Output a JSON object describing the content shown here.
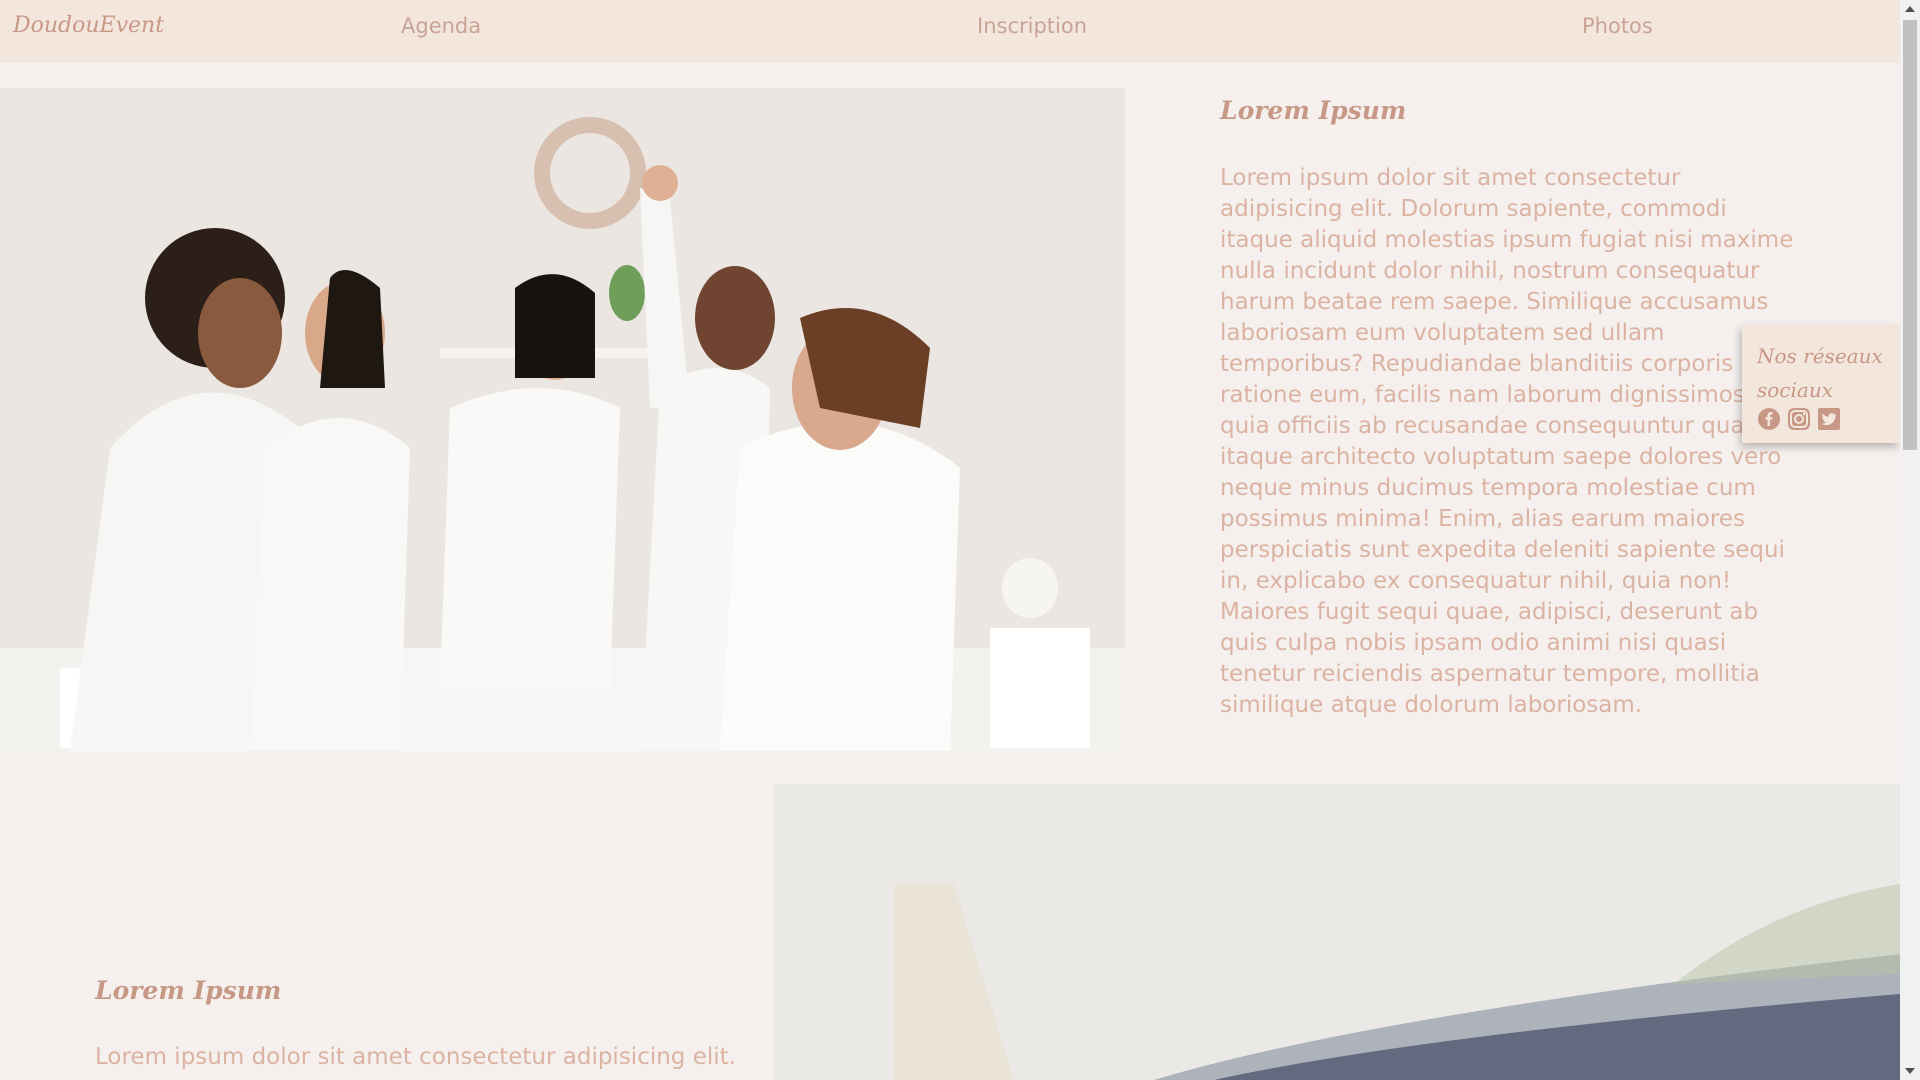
{
  "navbar": {
    "brand": "DoudouEvent",
    "links": [
      "Agenda",
      "Inscription",
      "Photos"
    ]
  },
  "section1": {
    "heading": "Lorem Ipsum",
    "paragraph": "Lorem ipsum dolor sit amet consectetur adipisicing elit. Dolorum sapiente, commodi itaque aliquid molestias ipsum fugiat nisi maxime nulla incidunt dolor nihil, nostrum consequatur harum beatae rem saepe. Similique accusamus laboriosam eum voluptatem sed ullam temporibus? Repudiandae blanditiis corporis ratione eum, facilis nam laborum dignissimos quia officiis ab recusandae consequuntur quae, itaque architecto voluptatum saepe dolores vero neque minus ducimus tempora molestiae cum possimus minima! Enim, alias earum maiores perspiciatis sunt expedita deleniti sapiente sequi in, explicabo ex consequatur nihil, quia non! Maiores fugit sequi quae, adipisci, deserunt ab quis culpa nobis ipsam odio animi nisi quasi tenetur reiciendis aspernatur tempore, mollitia similique atque dolorum laboriosam."
  },
  "section2": {
    "heading": "Lorem Ipsum",
    "paragraph": "Lorem ipsum dolor sit amet consectetur adipisicing elit."
  },
  "social": {
    "title": "Nos réseaux sociaux",
    "icons": [
      "facebook-icon",
      "instagram-icon",
      "twitter-icon"
    ]
  },
  "colors": {
    "background": "#f5f0ed",
    "navbar": "#f3e6dd",
    "accent": "#c89886",
    "text": "#dbb3a3"
  }
}
